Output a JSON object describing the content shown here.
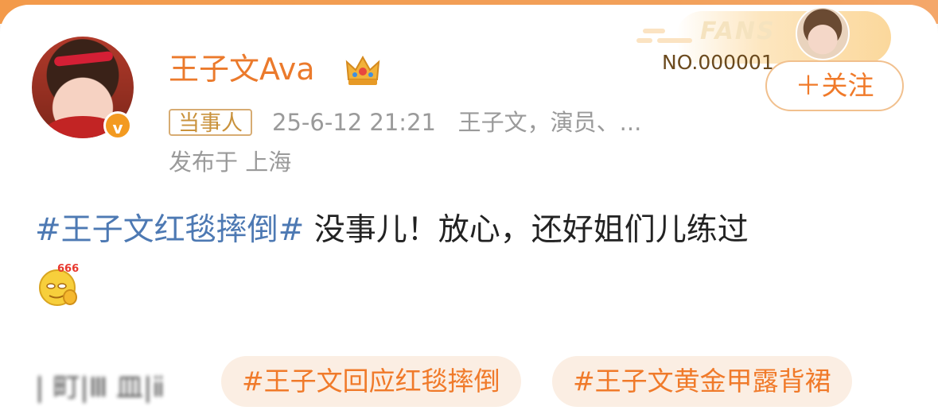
{
  "user": {
    "name": "王子文Ava",
    "tag": "当事人",
    "timestamp": "25-6-12 21:21",
    "description": "王子文，演员、...",
    "location": "发布于 上海",
    "verified_icon": "v-verified-icon",
    "crown_icon": "crown-icon"
  },
  "fans_badge": {
    "word": "FANS",
    "number": "NO.000001"
  },
  "follow_button": {
    "label": "＋关注"
  },
  "post": {
    "hashtag": "#王子文红毯摔倒#",
    "text": " 没事儿！放心，还好姐们儿练过",
    "emoji": "666"
  },
  "footer": {
    "blurred_text": "| 町|Ⅲ 皿|ⅱ",
    "topics": [
      "#王子文回应红毯摔倒",
      "#王子文黄金甲露背裙"
    ]
  },
  "colors": {
    "accent": "#eb7a2c",
    "hashtag": "#4d79b3",
    "meta": "#9a9a9a",
    "topic_bg": "#fbeee3"
  }
}
